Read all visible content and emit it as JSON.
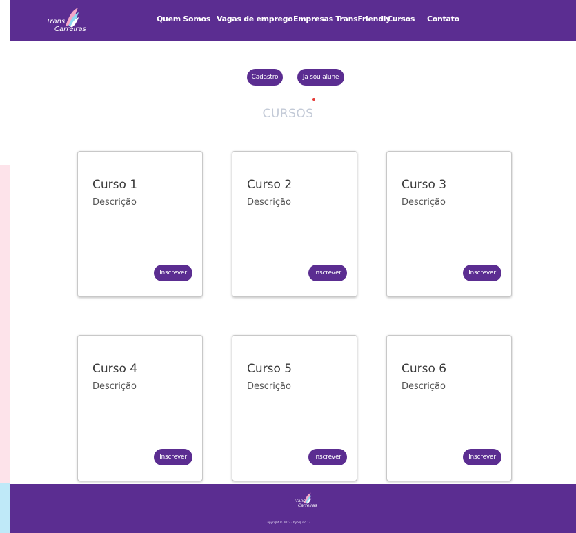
{
  "brand": {
    "line1": "Trans",
    "line2": "Carreiras",
    "accent": "#5b2d91"
  },
  "nav": [
    {
      "label": "Quem Somos"
    },
    {
      "label": "Vagas de emprego"
    },
    {
      "label": "Empresas TransFriendly"
    },
    {
      "label": "Cursos"
    },
    {
      "label": "Contato"
    }
  ],
  "actions": {
    "register_label": "Cadastro",
    "student_label": "Ja sou alune"
  },
  "page": {
    "title": "CURSOS"
  },
  "courses": [
    {
      "title": "Curso 1",
      "description": "Descrição",
      "button": "Inscrever"
    },
    {
      "title": "Curso 2",
      "description": "Descrição",
      "button": "Inscrever"
    },
    {
      "title": "Curso 3",
      "description": "Descrição",
      "button": "Inscrever"
    },
    {
      "title": "Curso 4",
      "description": "Descrição",
      "button": "Inscrever"
    },
    {
      "title": "Curso 5",
      "description": "Descrição",
      "button": "Inscrever"
    },
    {
      "title": "Curso 6",
      "description": "Descrição",
      "button": "Inscrever"
    }
  ],
  "footer": {
    "copyright": "Copyright © 2023 - by Squad 13"
  }
}
